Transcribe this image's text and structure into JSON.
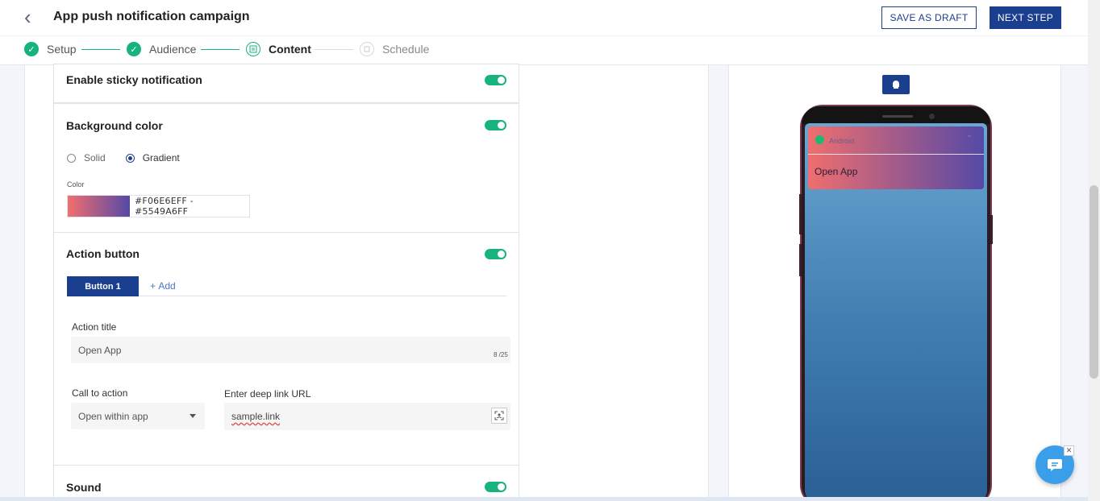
{
  "header": {
    "back_icon": "chevron-left-icon",
    "title": "App push notification campaign",
    "save_draft_label": "SAVE AS DRAFT",
    "next_step_label": "NEXT STEP"
  },
  "stepper": {
    "steps": [
      {
        "label": "Setup",
        "state": "done"
      },
      {
        "label": "Audience",
        "state": "done"
      },
      {
        "label": "Content",
        "state": "active"
      },
      {
        "label": "Schedule",
        "state": "pending"
      }
    ]
  },
  "sections": {
    "sticky": {
      "title": "Enable sticky notification",
      "enabled": true
    },
    "background": {
      "title": "Background color",
      "enabled": true,
      "options": [
        "Solid",
        "Gradient"
      ],
      "selected": "Gradient",
      "color_label": "Color",
      "color_value": "#F06E6EFF - #5549A6FF",
      "gradient_start": "#F06E6E",
      "gradient_end": "#5549A6"
    },
    "action": {
      "title": "Action button",
      "enabled": true,
      "tabs": [
        "Button 1"
      ],
      "add_label": "Add",
      "action_title_label": "Action title",
      "action_title_value": "Open App",
      "char_count": "8 /25",
      "cta_label": "Call to action",
      "cta_value": "Open within app",
      "deeplink_label": "Enter deep link URL",
      "deeplink_value": "sample.link"
    },
    "sound": {
      "title": "Sound",
      "enabled": true
    }
  },
  "preview": {
    "platform_icon": "android-icon",
    "app_name": "Android",
    "notification_text": "Open App"
  },
  "colors": {
    "accent": "#1A3F8F",
    "toggle_on": "#16B37E",
    "chat": "#3A9EE8"
  }
}
